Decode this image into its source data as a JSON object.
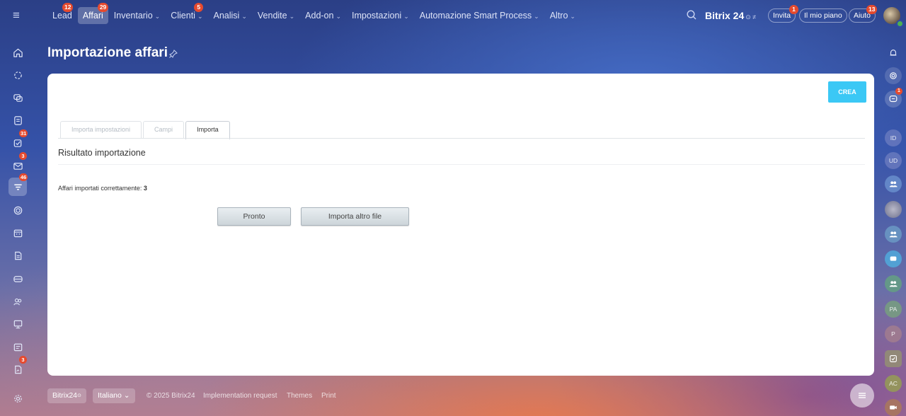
{
  "topbar": {
    "nav": [
      {
        "label": "Lead",
        "badge": "12",
        "dropdown": false,
        "active": false
      },
      {
        "label": "Affari",
        "badge": "29",
        "dropdown": false,
        "active": true
      },
      {
        "label": "Inventario",
        "badge": "",
        "dropdown": true,
        "active": false
      },
      {
        "label": "Clienti",
        "badge": "5",
        "dropdown": true,
        "active": false
      },
      {
        "label": "Analisi",
        "badge": "",
        "dropdown": true,
        "active": false
      },
      {
        "label": "Vendite",
        "badge": "",
        "dropdown": true,
        "active": false
      },
      {
        "label": "Add-on",
        "badge": "",
        "dropdown": true,
        "active": false
      },
      {
        "label": "Impostazioni",
        "badge": "",
        "dropdown": true,
        "active": false
      },
      {
        "label": "Automazione Smart Process",
        "badge": "",
        "dropdown": true,
        "active": false
      },
      {
        "label": "Altro",
        "badge": "",
        "dropdown": true,
        "active": false
      }
    ],
    "brand": "Bitrix 24",
    "brand_suffix": "⊙ ≠",
    "invite_label": "Invita",
    "invite_badge": "1",
    "plan_label": "Il mio piano",
    "help_label": "Aiuto",
    "help_badge": "13"
  },
  "left_sidebar": {
    "items": [
      {
        "icon": "home-icon",
        "badge": ""
      },
      {
        "icon": "feed-icon",
        "badge": ""
      },
      {
        "icon": "chat-icon",
        "badge": ""
      },
      {
        "icon": "tasks-list-icon",
        "badge": ""
      },
      {
        "icon": "checklist-icon",
        "badge": "31"
      },
      {
        "icon": "mail-icon",
        "badge": "3"
      },
      {
        "icon": "crm-funnel-icon",
        "badge": "46"
      },
      {
        "icon": "sites-icon",
        "badge": ""
      },
      {
        "icon": "calendar-icon",
        "badge": ""
      },
      {
        "icon": "document-icon",
        "badge": ""
      },
      {
        "icon": "inventory-icon",
        "badge": ""
      },
      {
        "icon": "employees-icon",
        "badge": ""
      },
      {
        "icon": "presentation-icon",
        "badge": ""
      },
      {
        "icon": "booking-icon",
        "badge": ""
      },
      {
        "icon": "signature-icon",
        "badge": "3"
      },
      {
        "icon": "settings-icon",
        "badge": ""
      }
    ]
  },
  "right_sidebar": {
    "items": [
      {
        "icon": "bell-icon",
        "label": "",
        "badge": ""
      },
      {
        "icon": "copilot-icon",
        "label": "",
        "badge": ""
      },
      {
        "icon": "messenger-icon",
        "label": "",
        "badge": "1"
      },
      {
        "icon": "avatar-icon",
        "label": "ID",
        "badge": ""
      },
      {
        "icon": "avatar-icon",
        "label": "UD",
        "badge": ""
      },
      {
        "icon": "group-icon",
        "label": "",
        "badge": ""
      },
      {
        "icon": "avatar-icon",
        "label": "",
        "badge": ""
      },
      {
        "icon": "group-icon",
        "label": "",
        "badge": ""
      },
      {
        "icon": "chat-bubble-icon",
        "label": "",
        "badge": ""
      },
      {
        "icon": "group-icon",
        "label": "",
        "badge": ""
      },
      {
        "icon": "avatar-icon",
        "label": "PA",
        "badge": ""
      },
      {
        "icon": "avatar-icon",
        "label": "P",
        "badge": ""
      },
      {
        "icon": "task-check-icon",
        "label": "",
        "badge": ""
      },
      {
        "icon": "avatar-icon",
        "label": "AC",
        "badge": ""
      },
      {
        "icon": "video-call-icon",
        "label": "",
        "badge": ""
      }
    ]
  },
  "page": {
    "title": "Importazione affari",
    "create_label": "CREA",
    "tabs": [
      {
        "label": "Importa impostazioni",
        "active": false
      },
      {
        "label": "Campi",
        "active": false
      },
      {
        "label": "Importa",
        "active": true
      }
    ],
    "section_title": "Risultato importazione",
    "result_label": "Affari importati correttamente:",
    "result_count": "3",
    "done_label": "Pronto",
    "import_other_label": "Importa altro file"
  },
  "footer": {
    "brand": "Bitrix24",
    "brand_suffix": "⊙",
    "language": "Italiano",
    "copyright": "© 2025 Bitrix24",
    "links": [
      "Implementation request",
      "Themes",
      "Print"
    ]
  },
  "colors": {
    "accent": "#3bc8f5",
    "badge": "#e64a2e"
  }
}
